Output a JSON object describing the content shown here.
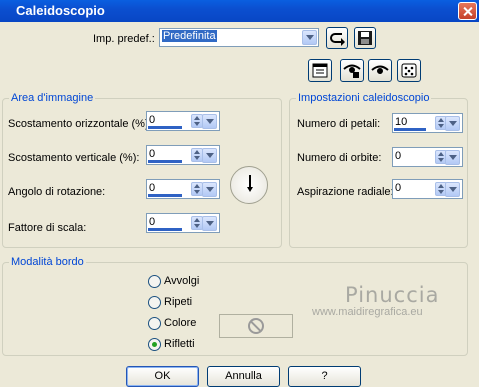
{
  "window": {
    "title": "Caleidoscopio",
    "close_icon": "close-icon"
  },
  "preset": {
    "label": "Imp. predef.:",
    "value": "Predefinita"
  },
  "image_area": {
    "legend": "Area d'immagine",
    "h_offset": {
      "label": "Scostamento orizzontale (%):",
      "value": "0"
    },
    "v_offset": {
      "label": "Scostamento verticale (%):",
      "value": "0"
    },
    "rotation": {
      "label": "Angolo di rotazione:",
      "value": "0"
    },
    "scale": {
      "label": "Fattore di scala:",
      "value": "0"
    }
  },
  "kaleido": {
    "legend": "Impostazioni caleidoscopio",
    "petals": {
      "label": "Numero di petali:",
      "value": "10"
    },
    "orbits": {
      "label": "Numero di orbite:",
      "value": "0"
    },
    "suction": {
      "label": "Aspirazione radiale:",
      "value": "0"
    }
  },
  "edge_mode": {
    "legend": "Modalità bordo",
    "options": [
      "Avvolgi",
      "Ripeti",
      "Colore",
      "Rifletti"
    ],
    "selected": "Rifletti"
  },
  "watermark": {
    "name": "Pinuccia",
    "site": "www.maidiregrafica.eu"
  },
  "buttons": {
    "ok": "OK",
    "cancel": "Annulla",
    "help": "?"
  }
}
